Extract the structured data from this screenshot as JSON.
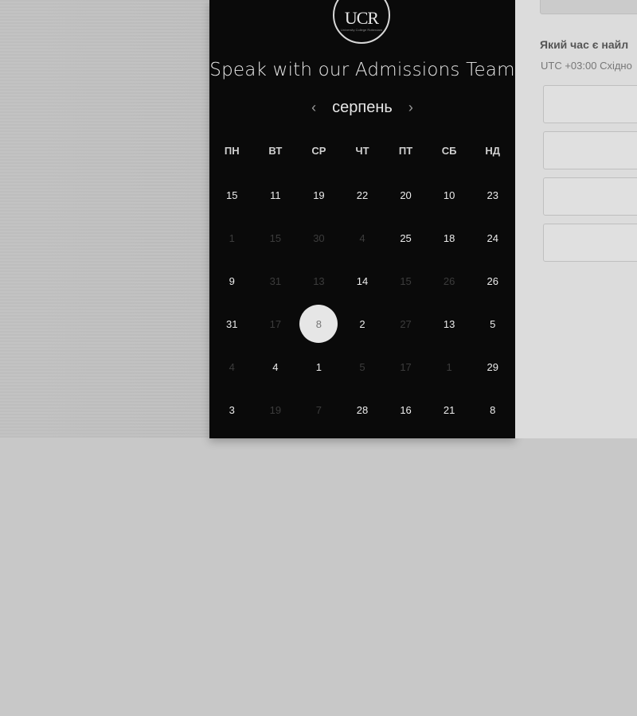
{
  "logo": {
    "text": "UCR",
    "subtext": "University College Rotterdam"
  },
  "title": "Speak with our Admissions Team",
  "calendar": {
    "month": "серпень",
    "weekdays": [
      "ПН",
      "ВТ",
      "СР",
      "ЧТ",
      "ПТ",
      "СБ",
      "НД"
    ],
    "rows": [
      [
        {
          "d": "15",
          "on": true
        },
        {
          "d": "11",
          "on": true
        },
        {
          "d": "19",
          "on": true
        },
        {
          "d": "22",
          "on": true
        },
        {
          "d": "20",
          "on": true
        },
        {
          "d": "10",
          "on": true
        },
        {
          "d": "23",
          "on": true
        }
      ],
      [
        {
          "d": "1",
          "on": false
        },
        {
          "d": "15",
          "on": false
        },
        {
          "d": "30",
          "on": false
        },
        {
          "d": "4",
          "on": false
        },
        {
          "d": "25",
          "on": true
        },
        {
          "d": "18",
          "on": true
        },
        {
          "d": "24",
          "on": true
        }
      ],
      [
        {
          "d": "9",
          "on": true
        },
        {
          "d": "31",
          "on": false
        },
        {
          "d": "13",
          "on": false
        },
        {
          "d": "14",
          "on": true
        },
        {
          "d": "15",
          "on": false
        },
        {
          "d": "26",
          "on": false
        },
        {
          "d": "26",
          "on": true
        }
      ],
      [
        {
          "d": "31",
          "on": true
        },
        {
          "d": "17",
          "on": false
        },
        {
          "d": "8",
          "on": true,
          "selected": true
        },
        {
          "d": "2",
          "on": true
        },
        {
          "d": "27",
          "on": false
        },
        {
          "d": "13",
          "on": true
        },
        {
          "d": "5",
          "on": true
        }
      ],
      [
        {
          "d": "4",
          "on": false
        },
        {
          "d": "4",
          "on": true
        },
        {
          "d": "1",
          "on": true
        },
        {
          "d": "5",
          "on": false
        },
        {
          "d": "17",
          "on": false
        },
        {
          "d": "1",
          "on": false
        },
        {
          "d": "29",
          "on": true
        }
      ],
      [
        {
          "d": "3",
          "on": true
        },
        {
          "d": "19",
          "on": false
        },
        {
          "d": "7",
          "on": false
        },
        {
          "d": "28",
          "on": true
        },
        {
          "d": "16",
          "on": true
        },
        {
          "d": "21",
          "on": true
        },
        {
          "d": "8",
          "on": true
        }
      ]
    ]
  },
  "right": {
    "question": "Який час є найл",
    "timezone": "UTC +03:00 Східно",
    "slots": [
      "",
      "",
      "",
      ""
    ]
  },
  "icons": {
    "prev": "chevron-left-icon",
    "next": "chevron-right-icon"
  }
}
